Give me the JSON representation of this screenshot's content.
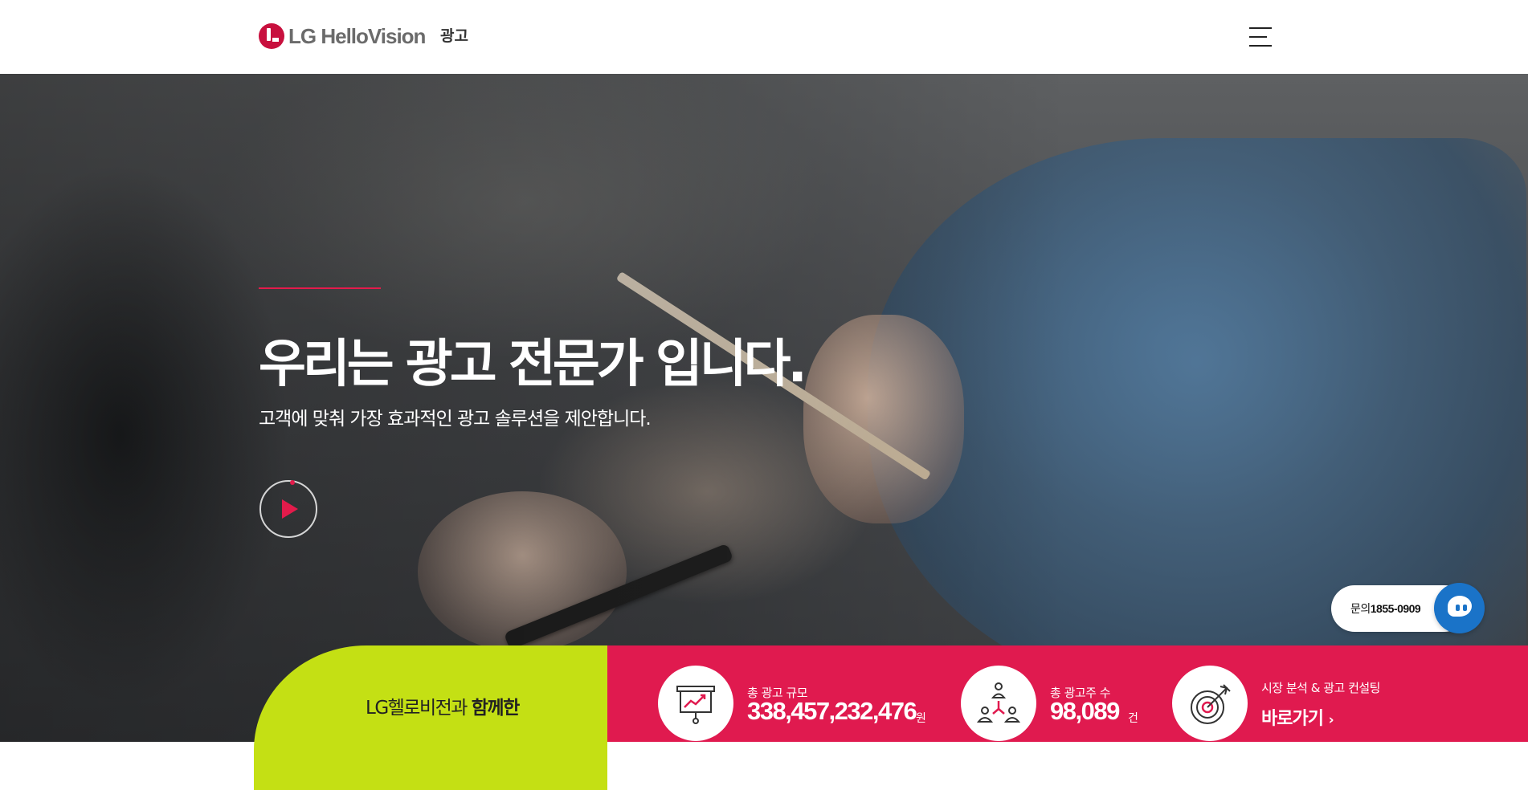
{
  "header": {
    "logo_text": "LG HelloVision",
    "nav_label": "광고"
  },
  "hero": {
    "title": "우리는 광고 전문가 입니다.",
    "subtitle": "고객에 맞춰 가장 효과적인 광고 솔루션을 제안합니다."
  },
  "contact": {
    "label": "문의",
    "phone": "1855-0909"
  },
  "band": {
    "intro_prefix": "LG헬로비전과 ",
    "intro_bold": "함께한",
    "stats": [
      {
        "label": "총 광고 규모",
        "value": "338,457,232,476",
        "unit": "원",
        "icon": "presentation-chart-icon"
      },
      {
        "label": "총 광고주 수",
        "value": "98,089",
        "unit": "건",
        "icon": "network-people-icon"
      }
    ],
    "cta": {
      "label": "시장 분석 & 광고 컨설팅",
      "link": "바로가기",
      "icon": "target-arrow-icon"
    }
  },
  "colors": {
    "accent_red": "#e01a4f",
    "accent_green": "#c4e014",
    "chat_blue": "#1a73c8"
  }
}
